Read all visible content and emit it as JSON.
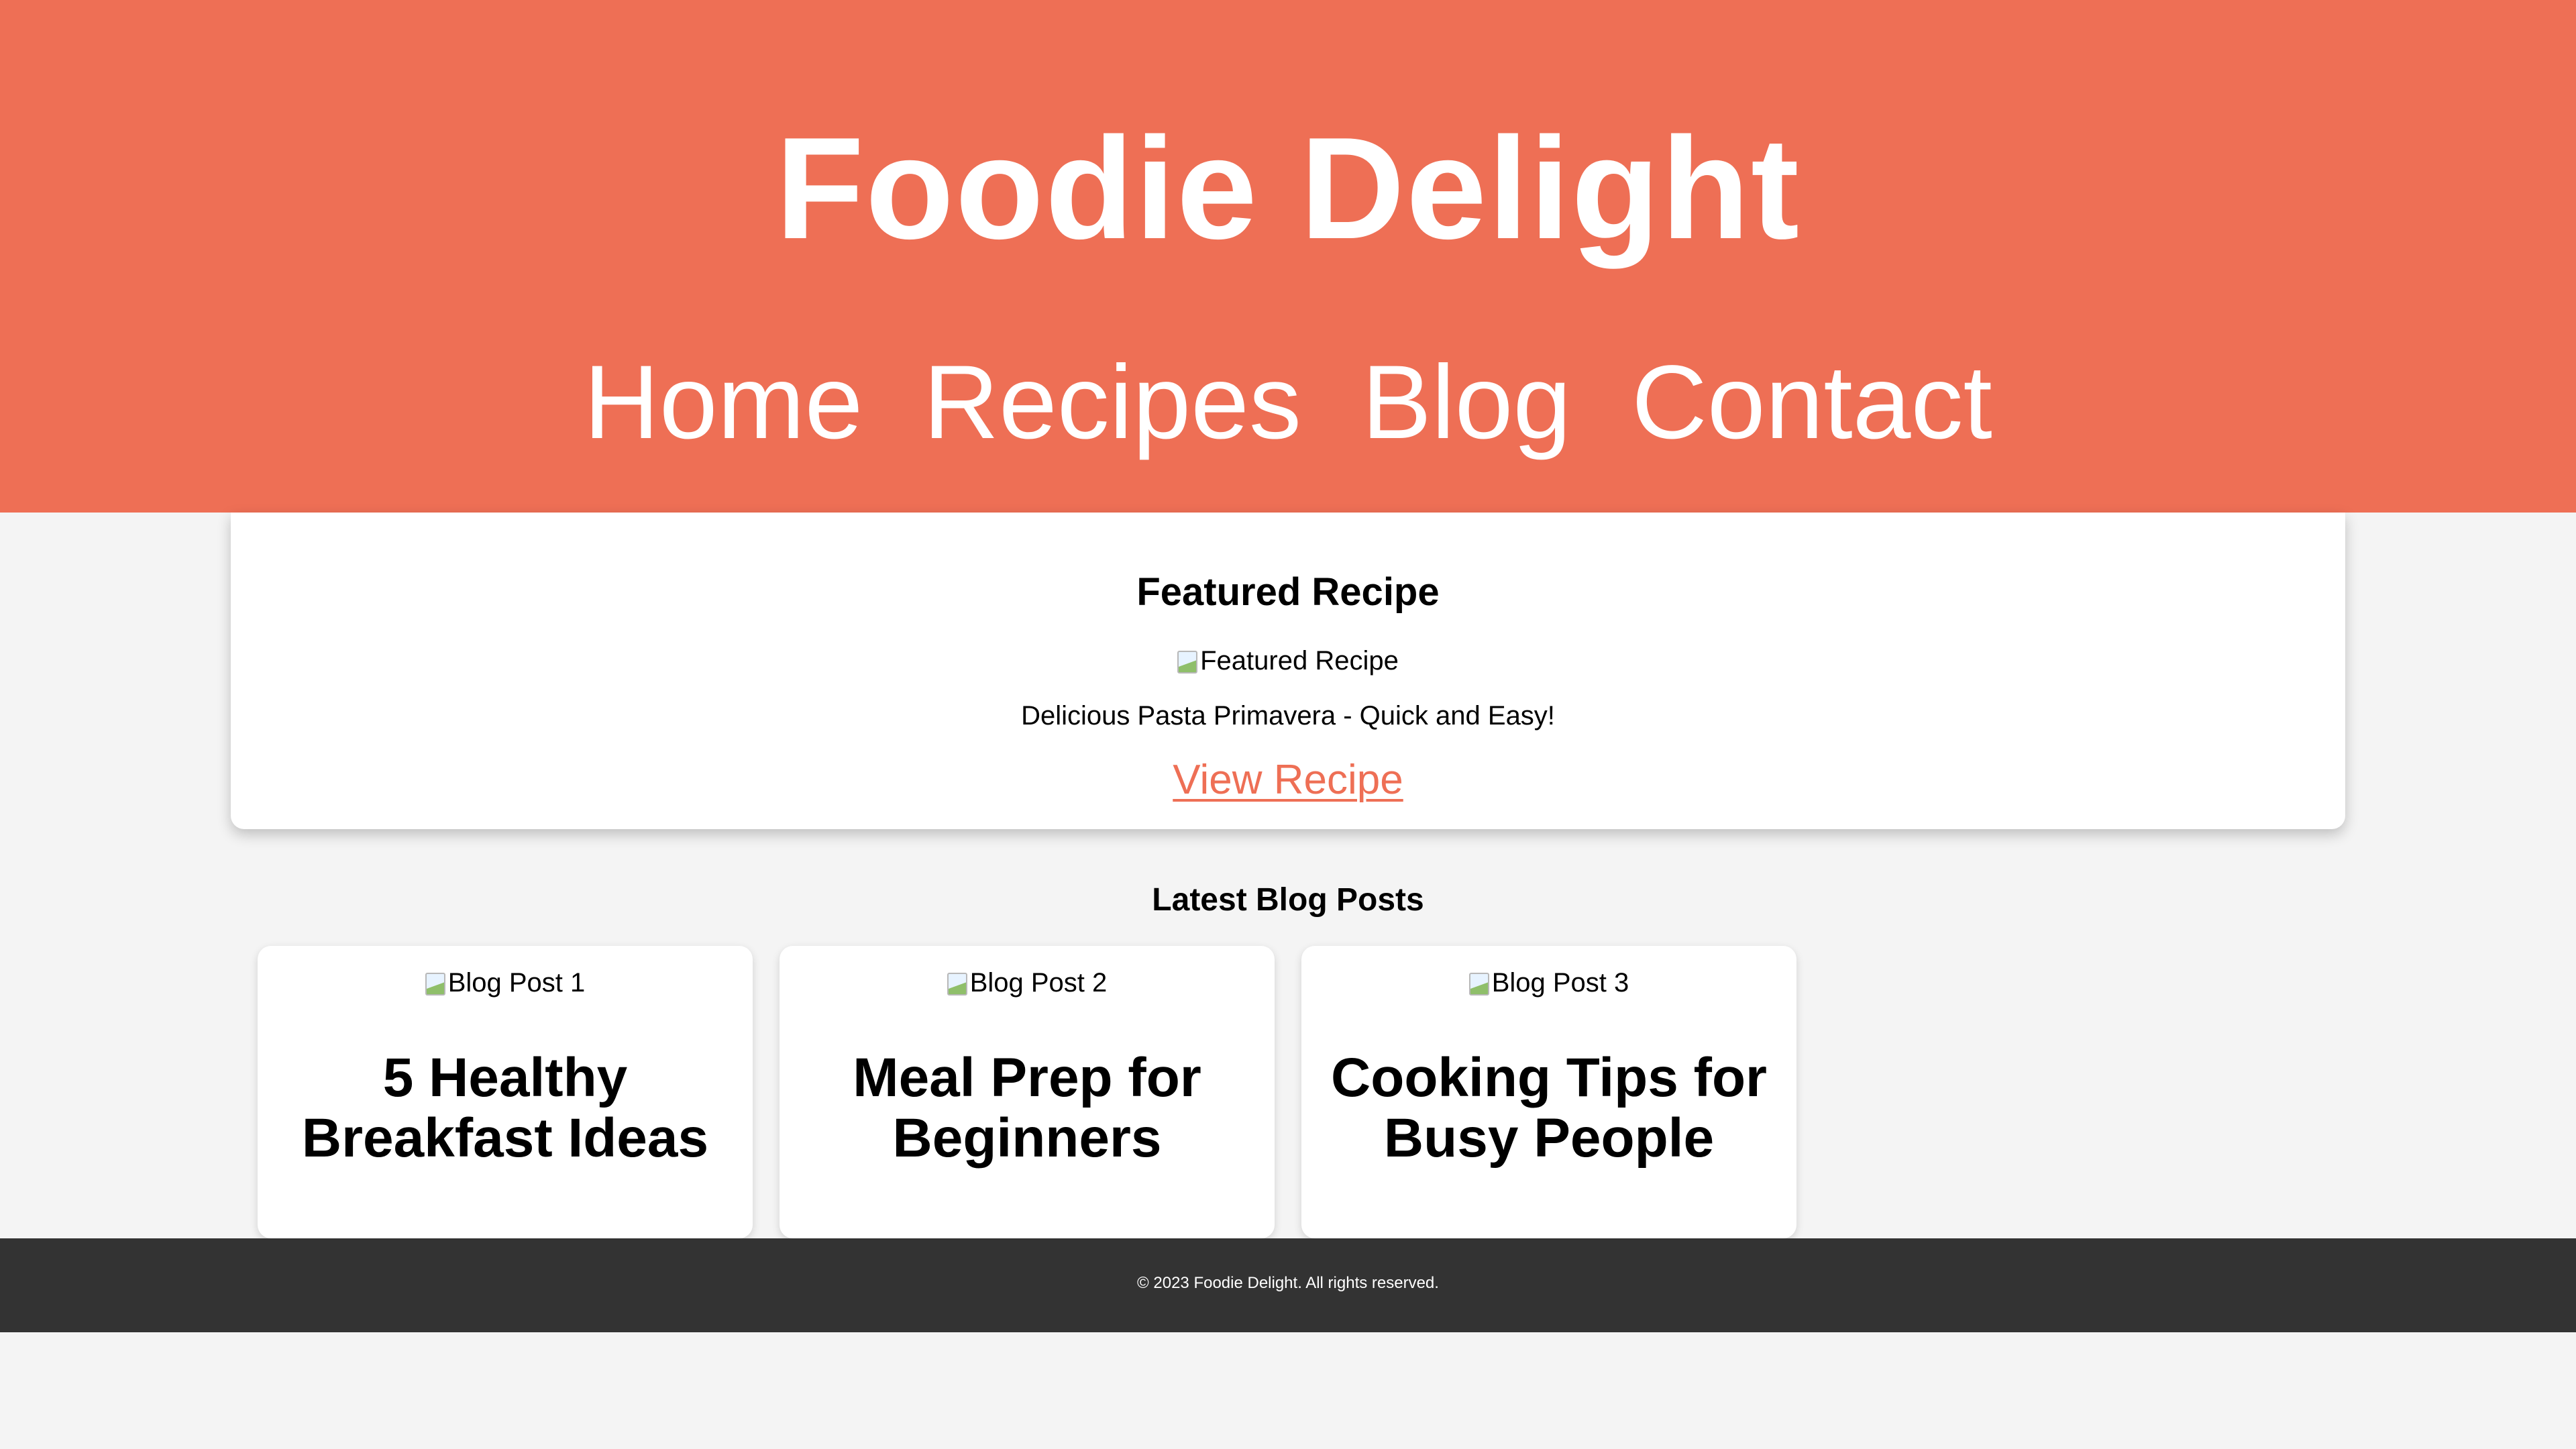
{
  "header": {
    "site_title": "Foodie Delight",
    "nav": [
      {
        "label": "Home"
      },
      {
        "label": "Recipes"
      },
      {
        "label": "Blog"
      },
      {
        "label": "Contact"
      }
    ]
  },
  "featured": {
    "title": "Featured Recipe",
    "image_alt": "Featured Recipe",
    "description": "Delicious Pasta Primavera - Quick and Easy!",
    "link_label": "View Recipe"
  },
  "blog": {
    "section_title": "Latest Blog Posts",
    "posts": [
      {
        "image_alt": "Blog Post 1",
        "title": "5 Healthy Breakfast Ideas"
      },
      {
        "image_alt": "Blog Post 2",
        "title": "Meal Prep for Beginners"
      },
      {
        "image_alt": "Blog Post 3",
        "title": "Cooking Tips for Busy People"
      }
    ]
  },
  "footer": {
    "text": "© 2023 Foodie Delight. All rights reserved."
  },
  "colors": {
    "brand": "#ee6f55",
    "footer_bg": "#333333",
    "page_bg": "#f4f4f4"
  },
  "icons": {
    "broken_image": "broken-image-icon"
  }
}
